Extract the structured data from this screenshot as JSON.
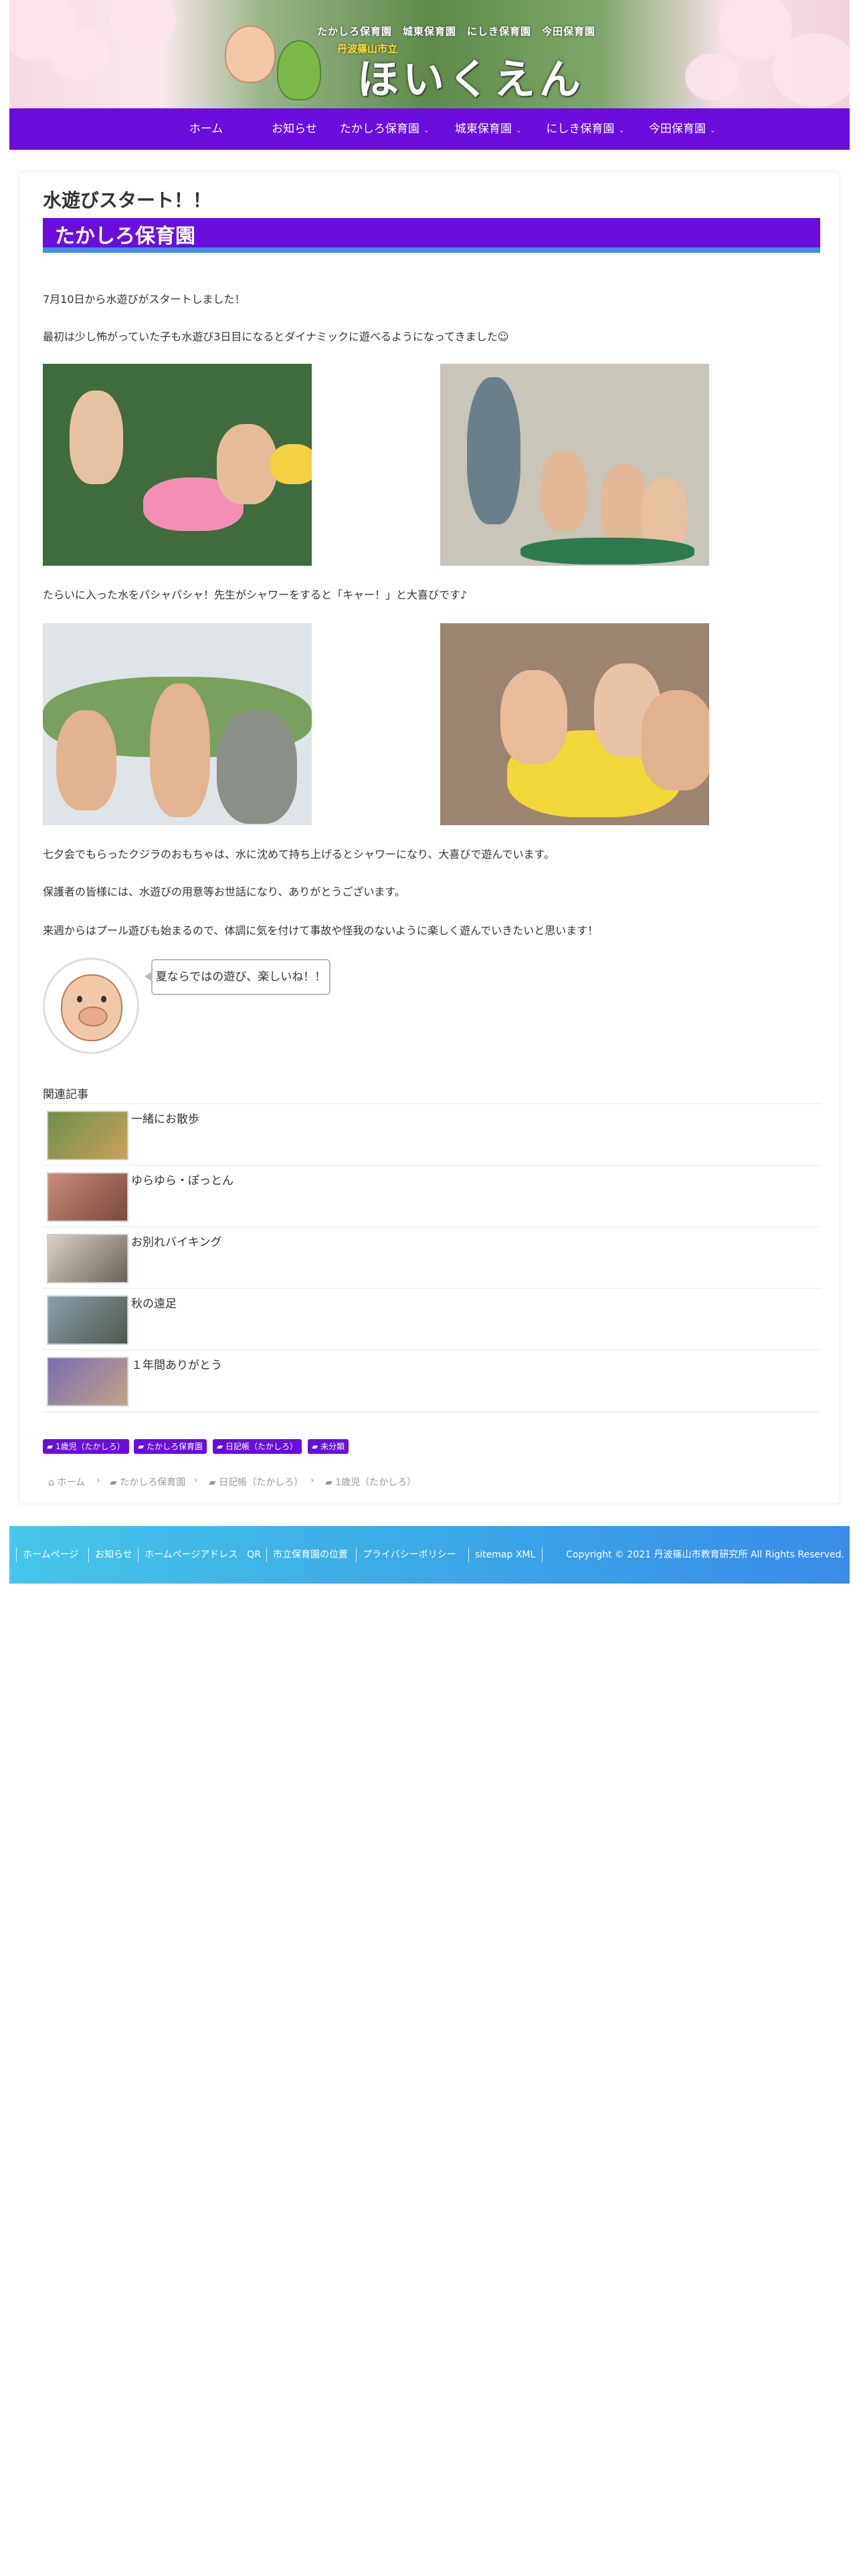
{
  "header": {
    "school_line": "たかしろ保育園　城東保育園　にしき保育園　今田保育園",
    "city": "丹波篠山市立",
    "logo": "ほいくえん"
  },
  "nav": {
    "items": [
      {
        "label": "ホーム",
        "has_submenu": false
      },
      {
        "label": "お知らせ",
        "has_submenu": false
      },
      {
        "label": "たかしろ保育園",
        "has_submenu": true
      },
      {
        "label": "城東保育園",
        "has_submenu": true
      },
      {
        "label": "にしき保育園",
        "has_submenu": true
      },
      {
        "label": "今田保育園",
        "has_submenu": true
      }
    ],
    "arrow": "⌄"
  },
  "article": {
    "title": "水遊びスタート！！",
    "category_banner": "たかしろ保育園",
    "p1": "7月10日から水遊びがスタートしました！",
    "p2": "最初は少し怖がっていた子も水遊び3日目になるとダイナミックに遊べるようになってきました☺",
    "p3": "たらいに入った水をパシャパシャ！先生がシャワーをすると「キャー！」と大喜びです♪",
    "p4": "七夕会でもらったクジラのおもちゃは、水に沈めて持ち上げるとシャワーになり、大喜びで遊んでいます。",
    "p5": "保護者の皆様には、水遊びの用意等お世話になり、ありがとうございます。",
    "p6": "来週からはプール遊びも始まるので、体調に気を付けて事故や怪我のないように楽しく遊んでいきたいと思います！",
    "speech": "夏ならではの遊び、楽しいね！！"
  },
  "related": {
    "heading": "関連記事",
    "items": [
      {
        "title": "一緒にお散歩"
      },
      {
        "title": "ゆらゆら・ぽっとん"
      },
      {
        "title": "お別れバイキング"
      },
      {
        "title": "秋の遠足"
      },
      {
        "title": "１年間ありがとう"
      }
    ]
  },
  "tags": [
    "1歳児（たかしろ）",
    "たかしろ保育園",
    "日記帳（たかしろ）",
    "未分類"
  ],
  "breadcrumb": {
    "items": [
      "ホーム",
      "たかしろ保育園",
      "日記帳（たかしろ）",
      "1歳児（たかしろ）"
    ],
    "separator": "›"
  },
  "footer": {
    "links": [
      "ホームページ",
      "お知らせ",
      "ホームページアドレス　QR",
      "市立保育園の位置",
      "プライバシーポリシー",
      "sitemap XML"
    ],
    "copyright": "Copyright © 2021 丹波篠山市教育研究所 All Rights Reserved."
  },
  "colors": {
    "nav": "#6a0ddd",
    "banner_underline": "#3f8fe8",
    "footer_start": "#46c6ea",
    "footer_end": "#3a8ce8"
  },
  "icons": {
    "home": "home-icon",
    "folder": "folder-icon"
  }
}
